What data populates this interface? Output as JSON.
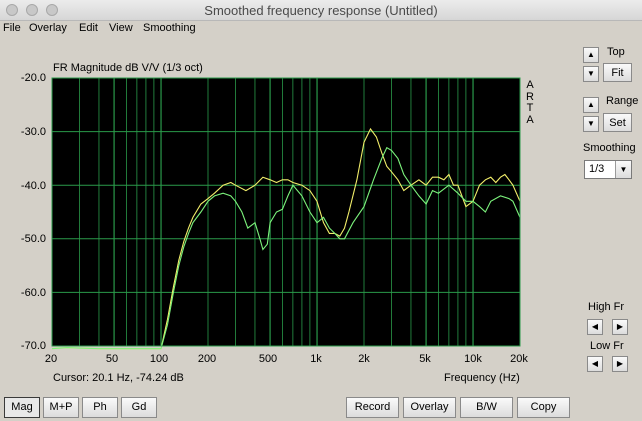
{
  "window": {
    "title": "Smoothed frequency response (Untitled)"
  },
  "menu": [
    "File",
    "Overlay",
    "Edit",
    "View",
    "Smoothing"
  ],
  "plot": {
    "heading": "FR Magnitude dB V/V (1/3 oct)",
    "arta_label": "A\nR\nT\nA",
    "cursor_text": "Cursor: 20.1 Hz, -74.24 dB",
    "x_axis_title": "Frequency (Hz)",
    "y_tick_labels": [
      "-20.0",
      "-30.0",
      "-40.0",
      "-50.0",
      "-60.0",
      "-70.0"
    ],
    "x_tick_labels": [
      "20",
      "50",
      "100",
      "200",
      "500",
      "1k",
      "2k",
      "5k",
      "10k",
      "20k"
    ]
  },
  "side_panel": {
    "top_label": "Top",
    "fit_label": "Fit",
    "range_label": "Range",
    "set_label": "Set",
    "smoothing_label": "Smoothing",
    "smoothing_value": "1/3",
    "high_fr_label": "High Fr",
    "low_fr_label": "Low Fr"
  },
  "bottom_buttons": {
    "mag": "Mag",
    "mp": "M+P",
    "ph": "Ph",
    "gd": "Gd",
    "record": "Record",
    "overlay": "Overlay",
    "bw": "B/W",
    "copy": "Copy"
  },
  "chart_data": {
    "type": "line",
    "title": "FR Magnitude dB V/V (1/3 oct)",
    "xlabel": "Frequency (Hz)",
    "ylabel": "",
    "xscale": "log",
    "xlim": [
      20,
      20000
    ],
    "ylim": [
      -70,
      -20
    ],
    "grid": true,
    "colors": {
      "background": "#000000",
      "grid": "#2a9a4a",
      "series1": "#f2ee6a",
      "series2": "#7cf27c"
    },
    "series": [
      {
        "x": [
          20,
          25,
          30,
          40,
          50,
          60,
          70,
          80,
          90,
          100,
          110,
          120,
          130,
          140,
          150,
          160,
          180,
          200,
          220,
          250,
          280,
          300,
          350,
          400,
          450,
          500,
          550,
          600,
          650,
          700,
          800,
          900,
          1000,
          1100,
          1200,
          1300,
          1400,
          1500,
          1600,
          1800,
          2000,
          2200,
          2400,
          2600,
          2800,
          3000,
          3300,
          3600,
          4000,
          4500,
          5000,
          5500,
          6000,
          6500,
          7000,
          7500,
          8000,
          9000,
          10000,
          11000,
          12000,
          13000,
          14000,
          15000,
          16000,
          17000,
          18000,
          20000
        ],
        "y": [
          -70.5,
          -70.3,
          -70.4,
          -70.5,
          -70.5,
          -70.5,
          -70.5,
          -70.5,
          -70.5,
          -70.5,
          -65,
          -59,
          -54,
          -50.5,
          -48,
          -46,
          -43.5,
          -42.5,
          -41.5,
          -40,
          -39.5,
          -40,
          -41,
          -40,
          -38.5,
          -39,
          -39.5,
          -39,
          -39,
          -39.5,
          -40,
          -41,
          -43,
          -47,
          -49,
          -49,
          -49.5,
          -48,
          -45,
          -39,
          -32,
          -29.5,
          -31,
          -34,
          -36.5,
          -37.5,
          -39,
          -41,
          -40,
          -39,
          -40,
          -38.5,
          -38.5,
          -39,
          -38,
          -40,
          -40,
          -44,
          -43,
          -40,
          -39,
          -38.5,
          -39.5,
          -38.5,
          -38,
          -39,
          -40,
          -43
        ]
      },
      {
        "x": [
          20,
          25,
          30,
          40,
          50,
          60,
          70,
          80,
          90,
          100,
          110,
          120,
          130,
          140,
          150,
          160,
          180,
          200,
          220,
          250,
          280,
          300,
          330,
          360,
          400,
          430,
          450,
          480,
          500,
          550,
          600,
          650,
          700,
          800,
          900,
          1000,
          1100,
          1200,
          1300,
          1400,
          1500,
          1700,
          2000,
          2300,
          2600,
          2800,
          3000,
          3300,
          3600,
          4000,
          4500,
          5000,
          5500,
          6000,
          7000,
          8000,
          9000,
          10000,
          11000,
          12000,
          13000,
          15000,
          17000,
          18000,
          20000
        ],
        "y": [
          -70.5,
          -70.3,
          -70.4,
          -70.5,
          -70.5,
          -70.5,
          -70.5,
          -70.5,
          -70.5,
          -70.5,
          -66,
          -60,
          -55,
          -51.5,
          -49,
          -47,
          -45,
          -43,
          -42,
          -41.5,
          -42,
          -43,
          -45,
          -48,
          -47,
          -50,
          -52,
          -51,
          -47,
          -45,
          -44.5,
          -42,
          -40,
          -42,
          -45,
          -47,
          -46,
          -48,
          -49,
          -50,
          -50,
          -47,
          -44,
          -39,
          -35,
          -33,
          -33.5,
          -35,
          -38,
          -40,
          -42,
          -43.5,
          -41,
          -41.5,
          -40,
          -41.5,
          -43,
          -43,
          -44,
          -45,
          -43,
          -42,
          -42.5,
          -43,
          -46
        ]
      }
    ]
  }
}
